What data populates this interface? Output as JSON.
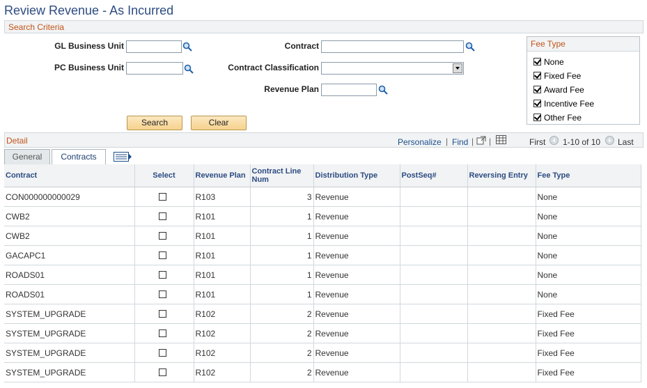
{
  "page": {
    "title": "Review Revenue - As Incurred"
  },
  "search_criteria": {
    "header": "Search Criteria",
    "gl_business_unit": {
      "label": "GL Business Unit",
      "value": ""
    },
    "pc_business_unit": {
      "label": "PC Business Unit",
      "value": ""
    },
    "contract": {
      "label": "Contract",
      "value": ""
    },
    "contract_classification": {
      "label": "Contract Classification",
      "value": ""
    },
    "revenue_plan": {
      "label": "Revenue Plan",
      "value": ""
    },
    "search_label": "Search",
    "clear_label": "Clear"
  },
  "fee_type": {
    "header": "Fee Type",
    "items": [
      {
        "label": "None",
        "checked": true
      },
      {
        "label": "Fixed Fee",
        "checked": true
      },
      {
        "label": "Award Fee",
        "checked": true
      },
      {
        "label": "Incentive Fee",
        "checked": true
      },
      {
        "label": "Other Fee",
        "checked": true
      }
    ]
  },
  "detail": {
    "title": "Detail",
    "personalize": "Personalize",
    "find": "Find",
    "sep": "|",
    "first": "First",
    "range": "1-10 of 10",
    "last": "Last",
    "tabs": [
      {
        "label": "General",
        "active": false
      },
      {
        "label": "Contracts",
        "active": true
      }
    ],
    "columns": {
      "contract": "Contract",
      "select": "Select",
      "revenue_plan": "Revenue Plan",
      "line_num": "Contract Line Num",
      "distribution_type": "Distribution Type",
      "postseq": "PostSeq#",
      "reversing": "Reversing Entry",
      "fee_type": "Fee Type"
    },
    "rows": [
      {
        "contract": "CON000000000029",
        "revenue_plan": "R103",
        "line_num": "3",
        "distribution_type": "Revenue",
        "postseq": "",
        "reversing": "",
        "fee_type": "None"
      },
      {
        "contract": "CWB2",
        "revenue_plan": "R101",
        "line_num": "1",
        "distribution_type": "Revenue",
        "postseq": "",
        "reversing": "",
        "fee_type": "None"
      },
      {
        "contract": "CWB2",
        "revenue_plan": "R101",
        "line_num": "1",
        "distribution_type": "Revenue",
        "postseq": "",
        "reversing": "",
        "fee_type": "None"
      },
      {
        "contract": "GACAPC1",
        "revenue_plan": "R101",
        "line_num": "1",
        "distribution_type": "Revenue",
        "postseq": "",
        "reversing": "",
        "fee_type": "None"
      },
      {
        "contract": "ROADS01",
        "revenue_plan": "R101",
        "line_num": "1",
        "distribution_type": "Revenue",
        "postseq": "",
        "reversing": "",
        "fee_type": "None"
      },
      {
        "contract": "ROADS01",
        "revenue_plan": "R101",
        "line_num": "1",
        "distribution_type": "Revenue",
        "postseq": "",
        "reversing": "",
        "fee_type": "None"
      },
      {
        "contract": "SYSTEM_UPGRADE",
        "revenue_plan": "R102",
        "line_num": "2",
        "distribution_type": "Revenue",
        "postseq": "",
        "reversing": "",
        "fee_type": "Fixed Fee"
      },
      {
        "contract": "SYSTEM_UPGRADE",
        "revenue_plan": "R102",
        "line_num": "2",
        "distribution_type": "Revenue",
        "postseq": "",
        "reversing": "",
        "fee_type": "Fixed Fee"
      },
      {
        "contract": "SYSTEM_UPGRADE",
        "revenue_plan": "R102",
        "line_num": "2",
        "distribution_type": "Revenue",
        "postseq": "",
        "reversing": "",
        "fee_type": "Fixed Fee"
      },
      {
        "contract": "SYSTEM_UPGRADE",
        "revenue_plan": "R102",
        "line_num": "2",
        "distribution_type": "Revenue",
        "postseq": "",
        "reversing": "",
        "fee_type": "Fixed Fee"
      }
    ]
  }
}
